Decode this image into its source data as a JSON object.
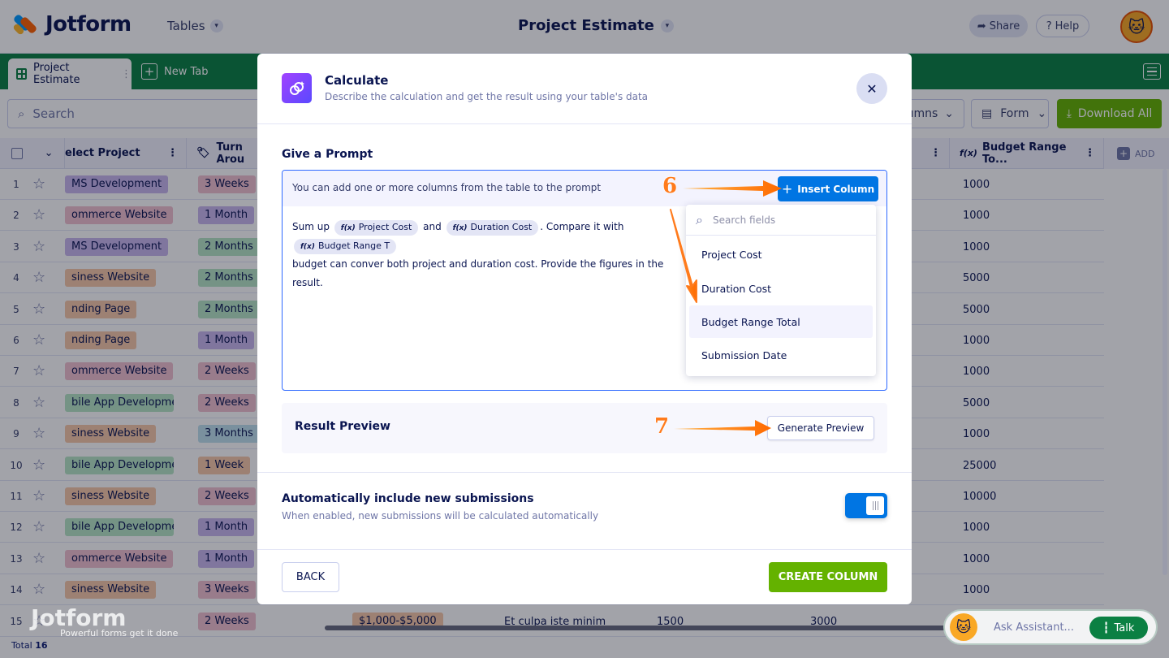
{
  "app": {
    "brand": "Jotform",
    "tables_label": "Tables",
    "doc_title": "Project Estimate",
    "share_label": "Share",
    "help_label": "Help"
  },
  "tabs": {
    "active": "Project Estimate",
    "new_tab": "New Tab"
  },
  "toolbar": {
    "search_placeholder": "Search",
    "columns_label": "lumns",
    "form_label": "Form",
    "download_label": "Download All"
  },
  "grid": {
    "columns": {
      "select_project": "elect Project",
      "turn_around": "Turn Arou",
      "budget_range": "Budget Range To...",
      "add": "ADD"
    },
    "rows": [
      {
        "num": "1",
        "project": "MS Development",
        "project_color": "#c9b6ee",
        "turn": "3 Weeks",
        "turn_color": "#f0c0cf",
        "budget": "1000"
      },
      {
        "num": "2",
        "project": "ommerce Website",
        "project_color": "#f0c0cf",
        "turn": "1 Month",
        "turn_color": "#c9b6ee",
        "budget": "1000"
      },
      {
        "num": "3",
        "project": "MS Development",
        "project_color": "#c9b6ee",
        "turn": "2 Months",
        "turn_color": "#b7e5c6",
        "budget": "1000"
      },
      {
        "num": "4",
        "project": "siness Website",
        "project_color": "#f7c9a8",
        "turn": "2 Months",
        "turn_color": "#b7e5c6",
        "budget": "5000"
      },
      {
        "num": "5",
        "project": "nding Page",
        "project_color": "#f7c9a8",
        "turn": "2 Months",
        "turn_color": "#b7e5c6",
        "budget": "5000"
      },
      {
        "num": "6",
        "project": "nding Page",
        "project_color": "#f7c9a8",
        "turn": "1 Month",
        "turn_color": "#c9b6ee",
        "budget": "1000"
      },
      {
        "num": "7",
        "project": "ommerce Website",
        "project_color": "#f0c0cf",
        "turn": "2 Weeks",
        "turn_color": "#f0c0cf",
        "budget": "1000"
      },
      {
        "num": "8",
        "project": "bile App Development",
        "project_color": "#b7e5c6",
        "turn": "2 Weeks",
        "turn_color": "#f0c0cf",
        "budget": "5000"
      },
      {
        "num": "9",
        "project": "siness Website",
        "project_color": "#f7c9a8",
        "turn": "3 Months",
        "turn_color": "#bfe0ee",
        "budget": "1000"
      },
      {
        "num": "10",
        "project": "bile App Development",
        "project_color": "#b7e5c6",
        "turn": "1 Week",
        "turn_color": "#f7c9a8",
        "budget": "25000"
      },
      {
        "num": "11",
        "project": "siness Website",
        "project_color": "#f7c9a8",
        "turn": "2 Weeks",
        "turn_color": "#f0c0cf",
        "budget": "10000"
      },
      {
        "num": "12",
        "project": "bile App Development",
        "project_color": "#b7e5c6",
        "turn": "1 Month",
        "turn_color": "#c9b6ee",
        "budget": "1000"
      },
      {
        "num": "13",
        "project": "ommerce Website",
        "project_color": "#f0c0cf",
        "turn": "1 Month",
        "turn_color": "#c9b6ee",
        "budget": "1000"
      },
      {
        "num": "14",
        "project": "siness Website",
        "project_color": "#f7c9a8",
        "turn": "3 Weeks",
        "turn_color": "#f0c0cf",
        "budget": "1000"
      }
    ],
    "row15": {
      "num": "15",
      "turn": "2 Weeks",
      "range": "$1,000-$5,000",
      "text": "Et culpa iste minim",
      "v1": "1500",
      "v2": "3000"
    },
    "total_label": "Total",
    "total_count": "16"
  },
  "watermark": {
    "brand": "Jotform",
    "tagline": "Powerful forms get it done"
  },
  "assistant": {
    "placeholder": "Ask Assistant...",
    "talk_label": "Talk"
  },
  "modal": {
    "title": "Calculate",
    "subtitle": "Describe the calculation and get the result using your table's data",
    "prompt_label": "Give a Prompt",
    "prompt_hint": "You can add one or more columns from the table to the prompt",
    "insert_label": "Insert Column",
    "prompt_text": {
      "p1": "Sum up",
      "tag1": "Project Cost",
      "p2": "and",
      "tag2": "Duration Cost",
      "p3": ". Compare it with",
      "tag3": "Budget Range T",
      "p4": "budget can conver both project and duration cost. Provide the figures in the result."
    },
    "dropdown": {
      "search_placeholder": "Search fields",
      "items": [
        "Project Cost",
        "Duration Cost",
        "Budget Range Total",
        "Submission Date"
      ]
    },
    "preview_label": "Result Preview",
    "generate_label": "Generate Preview",
    "auto_title": "Automatically include new submissions",
    "auto_sub": "When enabled, new submissions will be calculated automatically",
    "toggle_on": true,
    "back_label": "BACK",
    "create_label": "CREATE COLUMN"
  },
  "annotations": {
    "step6": "6",
    "step7": "7",
    "color": "#ff7b1c"
  }
}
